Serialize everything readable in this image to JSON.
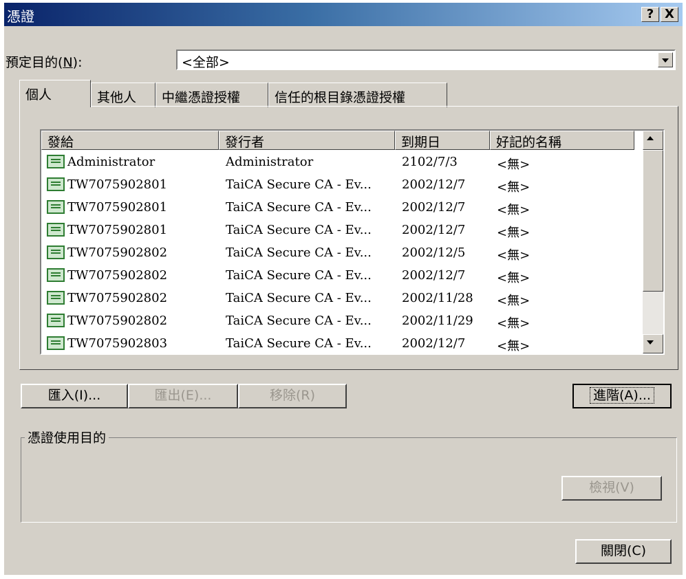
{
  "window": {
    "title": "憑證",
    "help_label": "?",
    "close_label": "X"
  },
  "purpose": {
    "label": "預定目的",
    "accel": "N",
    "label_suffix": "):",
    "value": "<全部>"
  },
  "tabs": [
    {
      "label": "個人"
    },
    {
      "label": "其他人"
    },
    {
      "label": "中繼憑證授權"
    },
    {
      "label": "信任的根目錄憑證授權"
    }
  ],
  "table": {
    "columns": [
      "發給",
      "發行者",
      "到期日",
      "好記的名稱"
    ],
    "rows": [
      [
        "Administrator",
        "Administrator",
        "2102/7/3",
        "<無>"
      ],
      [
        "TW7075902801",
        "TaiCA Secure CA - Ev...",
        "2002/12/7",
        "<無>"
      ],
      [
        "TW7075902801",
        "TaiCA Secure CA - Ev...",
        "2002/12/7",
        "<無>"
      ],
      [
        "TW7075902801",
        "TaiCA Secure CA - Ev...",
        "2002/12/7",
        "<無>"
      ],
      [
        "TW7075902802",
        "TaiCA Secure CA - Ev...",
        "2002/12/5",
        "<無>"
      ],
      [
        "TW7075902802",
        "TaiCA Secure CA - Ev...",
        "2002/12/7",
        "<無>"
      ],
      [
        "TW7075902802",
        "TaiCA Secure CA - Ev...",
        "2002/11/28",
        "<無>"
      ],
      [
        "TW7075902802",
        "TaiCA Secure CA - Ev...",
        "2002/11/29",
        "<無>"
      ],
      [
        "TW7075902803",
        "TaiCA Secure CA - Ev...",
        "2002/12/7",
        "<無>"
      ]
    ]
  },
  "buttons": {
    "import": "匯入(I)...",
    "export": "匯出(E)...",
    "remove": "移除(R)",
    "advanced": "進階(A)...",
    "view": "檢視(V)",
    "close": "關閉(C)"
  },
  "group": {
    "label": "憑證使用目的"
  },
  "icons": {
    "row_icon": "certificate-icon",
    "dropdown": "chevron-down-icon",
    "scroll_up": "scroll-up-arrow-icon",
    "scroll_down": "scroll-down-arrow-icon"
  }
}
